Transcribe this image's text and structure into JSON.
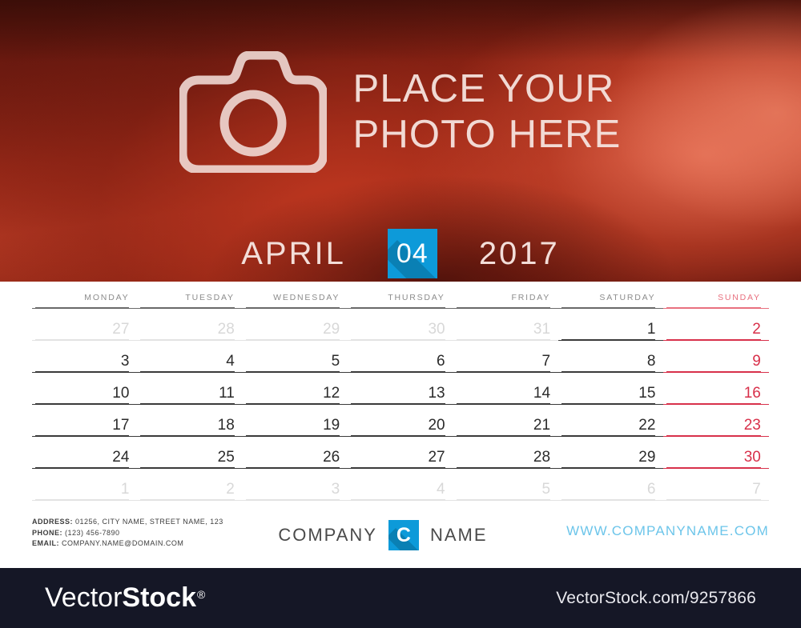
{
  "photo": {
    "placeholder_text": "PLACE YOUR\nPHOTO HERE",
    "camera_icon": "camera-icon"
  },
  "header": {
    "month_name": "APRIL",
    "month_number": "04",
    "year": "2017",
    "badge_color": "#0d9ad9"
  },
  "calendar": {
    "weekdays": [
      "MONDAY",
      "TUESDAY",
      "WEDNESDAY",
      "THURSDAY",
      "FRIDAY",
      "SATURDAY",
      "SUNDAY"
    ],
    "weeks": [
      [
        {
          "d": "27",
          "t": "other"
        },
        {
          "d": "28",
          "t": "other"
        },
        {
          "d": "29",
          "t": "other"
        },
        {
          "d": "30",
          "t": "other"
        },
        {
          "d": "31",
          "t": "other"
        },
        {
          "d": "1",
          "t": "day"
        },
        {
          "d": "2",
          "t": "sunday"
        }
      ],
      [
        {
          "d": "3",
          "t": "day"
        },
        {
          "d": "4",
          "t": "day"
        },
        {
          "d": "5",
          "t": "day"
        },
        {
          "d": "6",
          "t": "day"
        },
        {
          "d": "7",
          "t": "day"
        },
        {
          "d": "8",
          "t": "day"
        },
        {
          "d": "9",
          "t": "sunday"
        }
      ],
      [
        {
          "d": "10",
          "t": "day"
        },
        {
          "d": "11",
          "t": "day"
        },
        {
          "d": "12",
          "t": "day"
        },
        {
          "d": "13",
          "t": "day"
        },
        {
          "d": "14",
          "t": "day"
        },
        {
          "d": "15",
          "t": "day"
        },
        {
          "d": "16",
          "t": "sunday"
        }
      ],
      [
        {
          "d": "17",
          "t": "day"
        },
        {
          "d": "18",
          "t": "day"
        },
        {
          "d": "19",
          "t": "day"
        },
        {
          "d": "20",
          "t": "day"
        },
        {
          "d": "21",
          "t": "day"
        },
        {
          "d": "22",
          "t": "day"
        },
        {
          "d": "23",
          "t": "sunday"
        }
      ],
      [
        {
          "d": "24",
          "t": "day"
        },
        {
          "d": "25",
          "t": "day"
        },
        {
          "d": "26",
          "t": "day"
        },
        {
          "d": "27",
          "t": "day"
        },
        {
          "d": "28",
          "t": "day"
        },
        {
          "d": "29",
          "t": "day"
        },
        {
          "d": "30",
          "t": "sunday"
        }
      ],
      [
        {
          "d": "1",
          "t": "other"
        },
        {
          "d": "2",
          "t": "other"
        },
        {
          "d": "3",
          "t": "other"
        },
        {
          "d": "4",
          "t": "other"
        },
        {
          "d": "5",
          "t": "other"
        },
        {
          "d": "6",
          "t": "other"
        },
        {
          "d": "7",
          "t": "other"
        }
      ]
    ],
    "sunday_color": "#d8304a",
    "day_color": "#2b2b2b",
    "muted_color": "#d8d8d8"
  },
  "footer": {
    "address_label": "ADDRESS:",
    "address_value": " 01256, CITY NAME, STREET NAME, 123",
    "phone_label": "PHONE:",
    "phone_value": " (123) 456-7890",
    "email_label": "EMAIL:",
    "email_value": " COMPANY.NAME@DOMAIN.COM",
    "company_word1": "COMPANY",
    "company_mark": "C",
    "company_word2": "NAME",
    "website": "WWW.COMPANYNAME.COM",
    "website_color": "#6cc5ea"
  },
  "watermark": {
    "logo_light": "Vector",
    "logo_bold": "Stock",
    "registered": "®",
    "url": "VectorStock.com/9257866",
    "background": "#151726"
  }
}
